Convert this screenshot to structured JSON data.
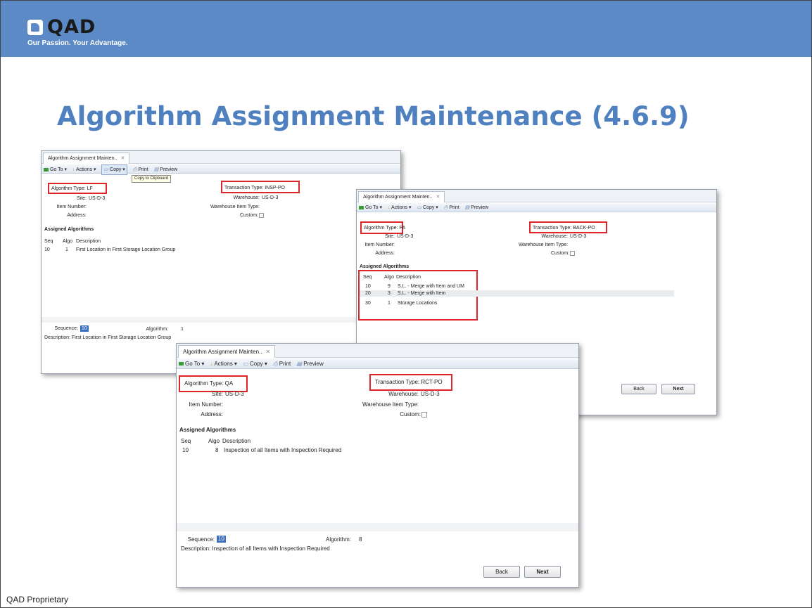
{
  "header": {
    "brand": "QAD",
    "tagline": "Our Passion. Your Advantage.",
    "bg_color": "#5b8ac6"
  },
  "slide": {
    "title": "Algorithm Assignment Maintenance (4.6.9)",
    "title_color": "#4f81c0",
    "footer": "QAD Proprietary"
  },
  "toolbar": {
    "goto": "Go To",
    "actions": "Actions",
    "copy": "Copy",
    "print": "Print",
    "preview": "Preview",
    "tooltip": "Copy to Clipboard"
  },
  "labels": {
    "algorithm_type": "Algorithm Type:",
    "transaction_type": "Transaction Type:",
    "site": "Site:",
    "warehouse": "Warehouse:",
    "item_number": "Item Number:",
    "warehouse_item_type": "Warehouse Item Type:",
    "address": "Address:",
    "custom": "Custom:",
    "assigned_algorithms": "Assigned Algorithms",
    "col_seq": "Seq",
    "col_algo": "Algo",
    "col_desc": "Description",
    "sequence": "Sequence:",
    "algorithm": "Algorithm:",
    "description": "Description:",
    "back": "Back",
    "next": "Next"
  },
  "windows": [
    {
      "tab": "Algorithm Assignment Mainten..",
      "algorithm_type": "LF",
      "transaction_type": "INSP-PO",
      "site": "US-D-3",
      "warehouse": "US-D-3",
      "rows": [
        {
          "seq": "10",
          "algo": "1",
          "desc": "First Location in First Storage Location Group"
        }
      ],
      "sequence": "10",
      "algorithm": "1",
      "description": "First Location in First Storage Location Group"
    },
    {
      "tab": "Algorithm Assignment Mainten..",
      "algorithm_type": "PA",
      "transaction_type": "BACK-PO",
      "site": "US-D-3",
      "warehouse": "US-D-3",
      "rows": [
        {
          "seq": "10",
          "algo": "9",
          "desc": "S.L. - Merge with Item and UM"
        },
        {
          "seq": "20",
          "algo": "3",
          "desc": "S.L. - Merge with Item"
        },
        {
          "seq": "30",
          "algo": "1",
          "desc": "Storage Locations"
        }
      ]
    },
    {
      "tab": "Algorithm Assignment Mainten..",
      "algorithm_type": "QA",
      "transaction_type": "RCT-PO",
      "site": "US-D-3",
      "warehouse": "US-D-3",
      "rows": [
        {
          "seq": "10",
          "algo": "8",
          "desc": "Inspection of all Items with Inspection Required"
        }
      ],
      "sequence": "10",
      "algorithm": "8",
      "description": "Inspection of all Items with Inspection Required"
    }
  ]
}
